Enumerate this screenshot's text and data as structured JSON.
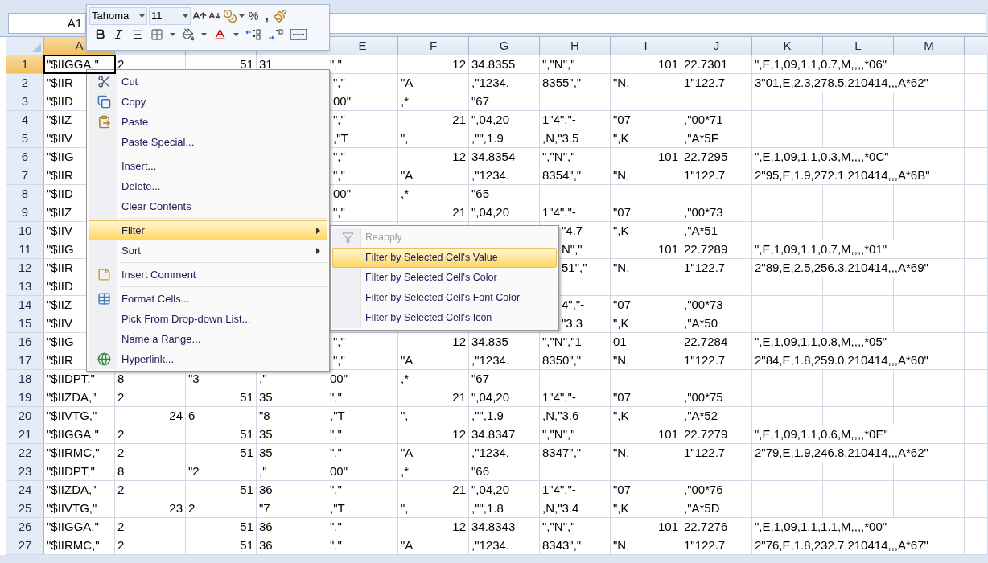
{
  "name_box": "A1",
  "mini_toolbar": {
    "font": "Tahoma",
    "size": "11",
    "percent": "%",
    "comma": ","
  },
  "grid": {
    "columns": [
      {
        "label": "A",
        "selected": true
      },
      {
        "selected": false
      },
      {
        "selected": false
      },
      {
        "selected": false
      },
      {
        "label": "E",
        "selected": false
      },
      {
        "label": "F",
        "selected": false
      },
      {
        "label": "G",
        "selected": false
      },
      {
        "label": "H",
        "selected": false
      },
      {
        "label": "I",
        "selected": false
      },
      {
        "label": "J",
        "selected": false
      },
      {
        "label": "K",
        "selected": false
      },
      {
        "label": "L",
        "selected": false
      },
      {
        "label": "M",
        "selected": false
      }
    ],
    "rows": [
      {
        "number": "1",
        "selected": true,
        "cells": [
          "\"$IIGGA,\"",
          "2",
          {
            "text": "51",
            "kind": "number"
          },
          "31",
          "\",\"",
          {
            "text": "12",
            "kind": "number"
          },
          "34.8355",
          "\",\"N\",\"",
          {
            "text": "101",
            "kind": "number"
          },
          "22.7301",
          "\",E,1,09,1.1,0.7,M,,,,*06\"",
          null,
          null
        ]
      },
      {
        "number": "2",
        "selected": false,
        "cells": [
          "\"$IIR",
          null,
          null,
          null,
          "\",\"",
          "\"A",
          ",\"1234.",
          "8355\",\"",
          "\"N,",
          "1\"122.7",
          "3\"01,E,2.3,278.5,210414,,,A*62\"",
          null,
          null
        ]
      },
      {
        "number": "3",
        "selected": false,
        "cells": [
          "\"$IID",
          null,
          null,
          null,
          "00\"",
          ",*",
          "\"67",
          null,
          null,
          null,
          null,
          null,
          null
        ]
      },
      {
        "number": "4",
        "selected": false,
        "cells": [
          "\"$IIZ",
          null,
          null,
          null,
          "\",\"",
          {
            "text": "21",
            "kind": "number"
          },
          "\",04,20",
          "1\"4\",\"-",
          "\"07",
          ",\"00*71",
          null,
          null,
          null
        ]
      },
      {
        "number": "5",
        "selected": false,
        "cells": [
          "\"$IIV",
          null,
          null,
          null,
          ",\"T",
          "\",",
          ",\"\",1.9",
          ",N,\"3.5",
          "\",K",
          ",\"A*5F",
          null,
          null,
          null
        ]
      },
      {
        "number": "6",
        "selected": false,
        "cells": [
          "\"$IIG",
          null,
          null,
          null,
          "\",\"",
          {
            "text": "12",
            "kind": "number"
          },
          "34.8354",
          "\",\"N\",\"",
          {
            "text": "101",
            "kind": "number"
          },
          "22.7295",
          "\",E,1,09,1.1,0.3,M,,,,*0C\"",
          null,
          null
        ]
      },
      {
        "number": "7",
        "selected": false,
        "cells": [
          "\"$IIR",
          null,
          null,
          null,
          "\",\"",
          "\"A",
          ",\"1234.",
          "8354\",\"",
          "\"N,",
          "1\"122.7",
          "2\"95,E,1.9,272.1,210414,,,A*6B\"",
          null,
          null
        ]
      },
      {
        "number": "8",
        "selected": false,
        "cells": [
          "\"$IID",
          null,
          null,
          null,
          "00\"",
          ",*",
          "\"65",
          null,
          null,
          null,
          null,
          null,
          null
        ]
      },
      {
        "number": "9",
        "selected": false,
        "cells": [
          "\"$IIZ",
          null,
          null,
          null,
          "\",\"",
          {
            "text": "21",
            "kind": "number"
          },
          "\",04,20",
          "1\"4\",\"-",
          "\"07",
          ",\"00*73",
          null,
          null,
          null
        ]
      },
      {
        "number": "10",
        "selected": false,
        "cells": [
          "\"$IIV",
          null,
          null,
          null,
          null,
          null,
          null,
          "\"4.7",
          "\",K",
          ",\"A*51",
          null,
          null,
          null
        ]
      },
      {
        "number": "11",
        "selected": false,
        "cells": [
          "\"$IIG",
          null,
          null,
          null,
          null,
          null,
          null,
          "N\",\"",
          {
            "text": "101",
            "kind": "number"
          },
          "22.7289",
          "\",E,1,09,1.1,0.7,M,,,,*01\"",
          null,
          null
        ]
      },
      {
        "number": "12",
        "selected": false,
        "cells": [
          "\"$IIR",
          null,
          null,
          null,
          null,
          null,
          null,
          "51\",\"",
          "\"N,",
          "1\"122.7",
          "2\"89,E,2.5,256.3,210414,,,A*69\"",
          null,
          null
        ]
      },
      {
        "number": "13",
        "selected": false,
        "cells": [
          "\"$IID",
          null,
          null,
          null,
          null,
          null,
          null,
          null,
          null,
          null,
          null,
          null,
          null
        ]
      },
      {
        "number": "14",
        "selected": false,
        "cells": [
          "\"$IIZ",
          null,
          null,
          null,
          null,
          null,
          null,
          "4\",\"-",
          "\"07",
          ",\"00*73",
          null,
          null,
          null
        ]
      },
      {
        "number": "15",
        "selected": false,
        "cells": [
          "\"$IIV",
          null,
          null,
          null,
          null,
          null,
          null,
          "\"3.3",
          "\",K",
          ",\"A*50",
          null,
          null,
          null
        ]
      },
      {
        "number": "16",
        "selected": false,
        "cells": [
          "\"$IIG",
          null,
          null,
          null,
          "\",\"",
          {
            "text": "12",
            "kind": "number"
          },
          "34.835",
          "\",\"N\",\"1",
          "01",
          "22.7284",
          "\",E,1,09,1.1,0.8,M,,,,*05\"",
          null,
          null
        ]
      },
      {
        "number": "17",
        "selected": false,
        "cells": [
          "\"$IIR",
          null,
          null,
          null,
          "\",\"",
          "\"A",
          ",\"1234.",
          "8350\",\"",
          "\"N,",
          "1\"122.7",
          "2\"84,E,1.8,259.0,210414,,,A*60\"",
          null,
          null
        ]
      },
      {
        "number": "18",
        "selected": false,
        "cells": [
          "\"$IIDPT,\"",
          "8",
          "\"3",
          ",\"",
          "00\"",
          ",*",
          "\"67",
          null,
          null,
          null,
          null,
          null,
          null
        ]
      },
      {
        "number": "19",
        "selected": false,
        "cells": [
          "\"$IIZDA,\"",
          "2",
          {
            "text": "51",
            "kind": "number"
          },
          "35",
          "\",\"",
          {
            "text": "21",
            "kind": "number"
          },
          "\",04,20",
          "1\"4\",\"-",
          "\"07",
          ",\"00*75",
          null,
          null,
          null
        ]
      },
      {
        "number": "20",
        "selected": false,
        "cells": [
          "\"$IIVTG,\"",
          {
            "text": "24",
            "kind": "number"
          },
          "6",
          "\"8",
          ",\"T",
          "\",",
          ",\"\",1.9",
          ",N,\"3.6",
          "\",K",
          ",\"A*52",
          null,
          null,
          null
        ]
      },
      {
        "number": "21",
        "selected": false,
        "cells": [
          "\"$IIGGA,\"",
          "2",
          {
            "text": "51",
            "kind": "number"
          },
          "35",
          "\",\"",
          {
            "text": "12",
            "kind": "number"
          },
          "34.8347",
          "\",\"N\",\"",
          {
            "text": "101",
            "kind": "number"
          },
          "22.7279",
          "\",E,1,09,1.1,0.6,M,,,,*0E\"",
          null,
          null
        ]
      },
      {
        "number": "22",
        "selected": false,
        "cells": [
          "\"$IIRMC,\"",
          "2",
          {
            "text": "51",
            "kind": "number"
          },
          "35",
          "\",\"",
          "\"A",
          ",\"1234.",
          "8347\",\"",
          "\"N,",
          "1\"122.7",
          "2\"79,E,1.9,246.8,210414,,,A*62\"",
          null,
          null
        ]
      },
      {
        "number": "23",
        "selected": false,
        "cells": [
          "\"$IIDPT,\"",
          "8",
          "\"2",
          ",\"",
          "00\"",
          ",*",
          "\"66",
          null,
          null,
          null,
          null,
          null,
          null
        ]
      },
      {
        "number": "24",
        "selected": false,
        "cells": [
          "\"$IIZDA,\"",
          "2",
          {
            "text": "51",
            "kind": "number"
          },
          "36",
          "\",\"",
          {
            "text": "21",
            "kind": "number"
          },
          "\",04,20",
          "1\"4\",\"-",
          "\"07",
          ",\"00*76",
          null,
          null,
          null
        ]
      },
      {
        "number": "25",
        "selected": false,
        "cells": [
          "\"$IIVTG,\"",
          {
            "text": "23",
            "kind": "number"
          },
          "2",
          "\"7",
          ",\"T",
          "\",",
          ",\"\",1.8",
          ",N,\"3.4",
          "\",K",
          ",\"A*5D",
          null,
          null,
          null
        ]
      },
      {
        "number": "26",
        "selected": false,
        "cells": [
          "\"$IIGGA,\"",
          "2",
          {
            "text": "51",
            "kind": "number"
          },
          "36",
          "\",\"",
          {
            "text": "12",
            "kind": "number"
          },
          "34.8343",
          "\",\"N\",\"",
          {
            "text": "101",
            "kind": "number"
          },
          "22.7276",
          "\",E,1,09,1.1,1.1,M,,,,*00\"",
          null,
          null
        ]
      },
      {
        "number": "27",
        "selected": false,
        "cells": [
          "\"$IIRMC,\"",
          "2",
          {
            "text": "51",
            "kind": "number"
          },
          "36",
          "\",\"",
          "\"A",
          ",\"1234.",
          "8343\",\"",
          "\"N,",
          "1\"122.7",
          "2\"76,E,1.8,232.7,210414,,,A*67\"",
          null,
          null
        ]
      }
    ]
  },
  "context_menu": {
    "groups": [
      {
        "items": [
          {
            "label": "Cut",
            "selected": false,
            "submenu": false
          },
          {
            "label": "Copy",
            "selected": false,
            "submenu": false
          },
          {
            "label": "Paste",
            "selected": false,
            "submenu": false
          },
          {
            "label": "Paste Special...",
            "selected": false,
            "submenu": false
          }
        ]
      },
      {
        "items": [
          {
            "label": "Insert...",
            "selected": false,
            "submenu": false
          },
          {
            "label": "Delete...",
            "selected": false,
            "submenu": false
          },
          {
            "label": "Clear Contents",
            "selected": false,
            "submenu": false
          }
        ]
      },
      {
        "items": [
          {
            "label": "Filter",
            "selected": true,
            "submenu": true
          },
          {
            "label": "Sort",
            "selected": false,
            "submenu": true
          }
        ]
      },
      {
        "items": [
          {
            "label": "Insert Comment",
            "selected": false,
            "submenu": false
          }
        ]
      },
      {
        "items": [
          {
            "label": "Format Cells...",
            "selected": false,
            "submenu": false
          },
          {
            "label": "Pick From Drop-down List...",
            "selected": false,
            "submenu": false
          },
          {
            "label": "Name a Range...",
            "selected": false,
            "submenu": false
          },
          {
            "label": "Hyperlink...",
            "selected": false,
            "submenu": false
          }
        ]
      }
    ]
  },
  "filter_submenu": {
    "items": [
      {
        "label": "Reapply",
        "selected": false,
        "disabled": true
      },
      {
        "label": "Filter by Selected Cell's Value",
        "selected": true,
        "disabled": false
      },
      {
        "label": "Filter by Selected Cell's Color",
        "selected": false,
        "disabled": false
      },
      {
        "label": "Filter by Selected Cell's Font Color",
        "selected": false,
        "disabled": false
      },
      {
        "label": "Filter by Selected Cell's Icon",
        "selected": false,
        "disabled": false
      }
    ]
  }
}
